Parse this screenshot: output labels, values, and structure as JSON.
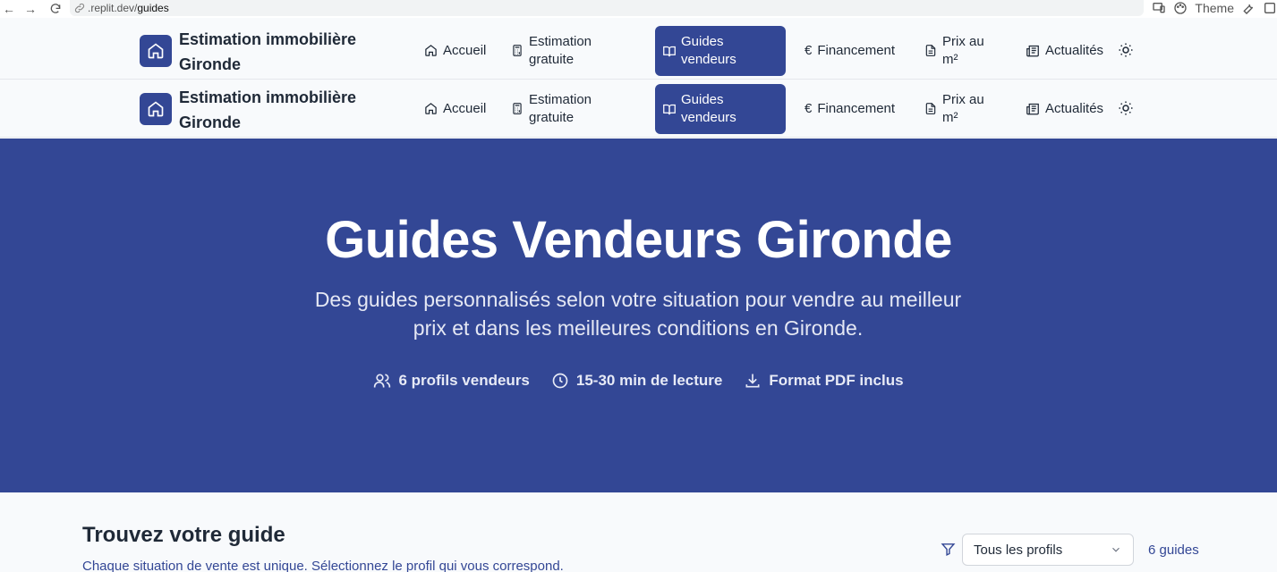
{
  "browser": {
    "url_prefix": ".replit.dev/",
    "url_path": "guides",
    "theme_label": "Theme"
  },
  "site": {
    "brand_line1": "Estimation immobilière",
    "brand_line2": "Gironde",
    "nav": {
      "home": "Accueil",
      "estimate_1": "Estimation",
      "estimate_2": "gratuite",
      "guides_1": "Guides",
      "guides_2": "vendeurs",
      "financing": "Financement",
      "price_1": "Prix au",
      "price_2": "m²",
      "news": "Actualités"
    },
    "icons": [
      "home-icon",
      "calculator-icon",
      "book-open-icon",
      "euro-icon",
      "file-text-icon",
      "newspaper-icon",
      "sun-icon"
    ]
  },
  "hero": {
    "title": "Guides Vendeurs Gironde",
    "subtitle_1": "Des guides personnalisés selon votre situation pour vendre au meilleur",
    "subtitle_2": "prix et dans les meilleures conditions en Gironde.",
    "stats": {
      "profiles": "6 profils vendeurs",
      "reading": "15-30 min de lecture",
      "pdf": "Format PDF inclus"
    }
  },
  "finder": {
    "title": "Trouvez votre guide",
    "subtitle": "Chaque situation de vente est unique. Sélectionnez le profil qui vous correspond.",
    "select_value": "Tous les profils",
    "count": "6 guides"
  },
  "colors": {
    "primary": "#334795",
    "background": "#f8fafc",
    "text": "#1f2937"
  }
}
